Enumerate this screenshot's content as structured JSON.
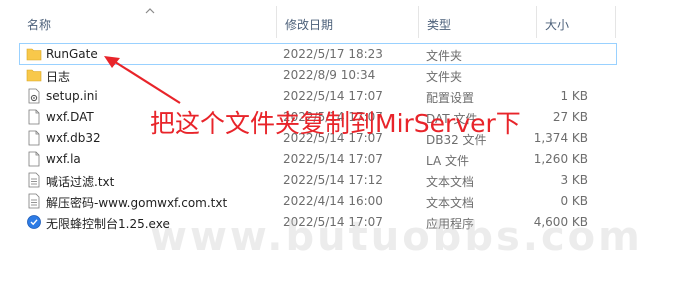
{
  "columns": {
    "name": "名称",
    "date": "修改日期",
    "type": "类型",
    "size": "大小"
  },
  "files": [
    {
      "name": "RunGate",
      "date": "2022/5/17 18:23",
      "type": "文件夹",
      "size": "",
      "icon": "folder-icon"
    },
    {
      "name": "日志",
      "date": "2022/8/9 10:34",
      "type": "文件夹",
      "size": "",
      "icon": "folder-icon"
    },
    {
      "name": "setup.ini",
      "date": "2022/5/14 17:07",
      "type": "配置设置",
      "size": "1 KB",
      "icon": "settings-file-icon"
    },
    {
      "name": "wxf.DAT",
      "date": "2022/5/14 17:07",
      "type": "DAT 文件",
      "size": "27 KB",
      "icon": "file-icon"
    },
    {
      "name": "wxf.db32",
      "date": "2022/5/14 17:07",
      "type": "DB32 文件",
      "size": "1,374 KB",
      "icon": "file-icon"
    },
    {
      "name": "wxf.la",
      "date": "2022/5/14 17:07",
      "type": "LA 文件",
      "size": "1,260 KB",
      "icon": "file-icon"
    },
    {
      "name": "喊话过滤.txt",
      "date": "2022/5/14 17:12",
      "type": "文本文档",
      "size": "3 KB",
      "icon": "text-file-icon"
    },
    {
      "name": "解压密码-www.gomwxf.com.txt",
      "date": "2022/4/14 16:00",
      "type": "文本文档",
      "size": "0 KB",
      "icon": "text-file-icon"
    },
    {
      "name": "无限蜂控制台1.25.exe",
      "date": "2022/5/14 17:07",
      "type": "应用程序",
      "size": "4,600 KB",
      "icon": "app-icon"
    }
  ],
  "annotation": "把这个文件夹复制到MirServer下",
  "watermark": "www.butuobbs.com",
  "colors": {
    "annotation": "#e8242a",
    "folder": "#f8c84a",
    "selection_border": "#99d1ff"
  }
}
